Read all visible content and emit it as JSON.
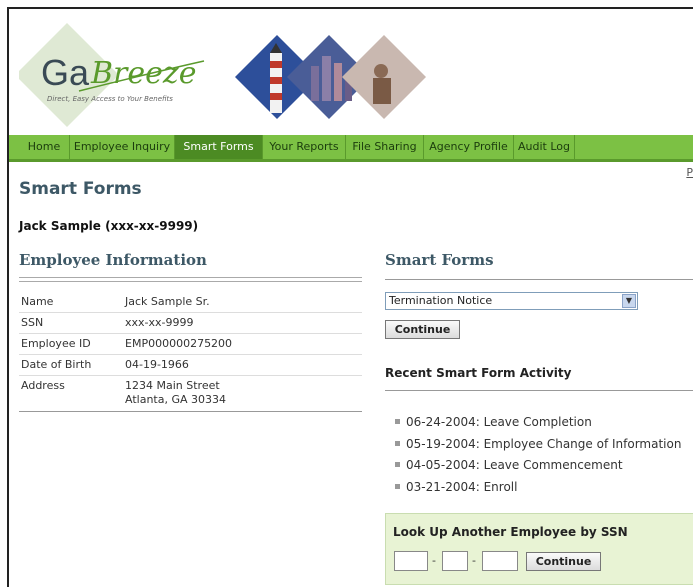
{
  "logo": {
    "brand_ga": "Ga",
    "brand_breeze": "Breeze",
    "tagline": "Direct, Easy Access to Your Benefits"
  },
  "nav": {
    "items": [
      "Home",
      "Employee Inquiry",
      "Smart Forms",
      "Your Reports",
      "File Sharing",
      "Agency Profile",
      "Audit Log"
    ],
    "active": "Smart Forms"
  },
  "top_link": "P",
  "page_title": "Smart Forms",
  "employee_header": "Jack Sample (xxx-xx-9999)",
  "employee_info": {
    "title": "Employee Information",
    "rows": [
      {
        "label": "Name",
        "value": "Jack Sample Sr."
      },
      {
        "label": "SSN",
        "value": "xxx-xx-9999"
      },
      {
        "label": "Employee ID",
        "value": "EMP000000275200"
      },
      {
        "label": "Date of Birth",
        "value": "04-19-1966"
      },
      {
        "label": "Address",
        "value": "1234 Main Street",
        "value2": "Atlanta, GA 30334"
      }
    ]
  },
  "smart_forms": {
    "title": "Smart Forms",
    "selected_form": "Termination Notice",
    "continue_label": "Continue"
  },
  "recent_activity": {
    "title": "Recent Smart Form Activity",
    "items": [
      "06-24-2004: Leave Completion",
      "05-19-2004: Employee Change of Information",
      "04-05-2004: Leave Commencement",
      "03-21-2004: Enroll"
    ]
  },
  "lookup": {
    "title": "Look Up Another Employee by SSN",
    "sep": "-",
    "ssn_part1": "",
    "ssn_part2": "",
    "ssn_part3": "",
    "continue_label": "Continue"
  },
  "colors": {
    "nav_green": "#7cc144",
    "nav_active": "#4c8b23",
    "heading": "#3d5866",
    "lookup_bg": "#e8f3d4"
  }
}
